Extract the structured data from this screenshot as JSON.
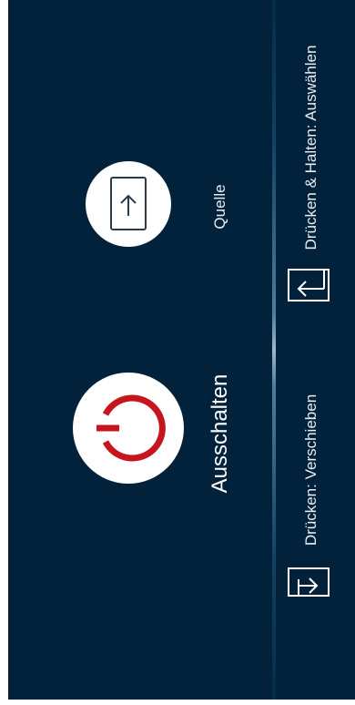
{
  "menu": {
    "power_label": "Ausschalten",
    "source_label": "Quelle",
    "hint_move": "Drücken: Verschieben",
    "hint_select": "Drücken & Halten: Auswählen"
  },
  "icons": {
    "power": "power-icon",
    "source": "source-input-icon",
    "hint_move": "press-icon",
    "hint_select": "press-and-hold-icon"
  },
  "colors": {
    "background": "#02223b",
    "power_icon": "#c4161c",
    "source_icon": "#2a3a48",
    "button_fill": "#ffffff"
  }
}
